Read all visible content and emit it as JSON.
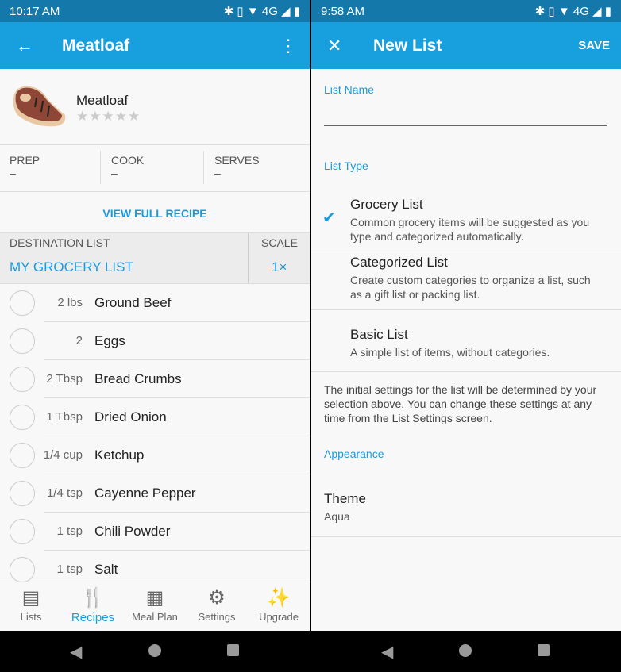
{
  "left": {
    "status": {
      "time": "10:17 AM",
      "icons": "✱ ▯ ▼ 4G ◢ ▮"
    },
    "appbar": {
      "title": "Meatloaf"
    },
    "recipe": {
      "name": "Meatloaf",
      "rating": 0,
      "stars": "★★★★★"
    },
    "times": [
      {
        "label": "PREP",
        "value": "–"
      },
      {
        "label": "COOK",
        "value": "–"
      },
      {
        "label": "SERVES",
        "value": "–"
      }
    ],
    "view_full": "VIEW FULL RECIPE",
    "destination": {
      "label": "DESTINATION LIST",
      "value": "MY GROCERY LIST",
      "scale_label": "SCALE",
      "scale_value": "1×"
    },
    "ingredients": [
      {
        "qty": "2 lbs",
        "name": "Ground Beef"
      },
      {
        "qty": "2",
        "name": "Eggs"
      },
      {
        "qty": "2 Tbsp",
        "name": "Bread Crumbs"
      },
      {
        "qty": "1 Tbsp",
        "name": "Dried Onion"
      },
      {
        "qty": "1/4 cup",
        "name": "Ketchup"
      },
      {
        "qty": "1/4 tsp",
        "name": "Cayenne Pepper"
      },
      {
        "qty": "1 tsp",
        "name": "Chili Powder"
      },
      {
        "qty": "1 tsp",
        "name": "Salt"
      }
    ],
    "tabs": [
      {
        "label": "Lists",
        "icon": "lists-icon"
      },
      {
        "label": "Recipes",
        "icon": "fork-spoon-icon",
        "active": true
      },
      {
        "label": "Meal Plan",
        "icon": "calendar-icon"
      },
      {
        "label": "Settings",
        "icon": "gear-icon"
      },
      {
        "label": "Upgrade",
        "icon": "magic-wand-icon"
      }
    ]
  },
  "right": {
    "status": {
      "time": "9:58 AM",
      "icons": "✱ ▯ ▼ 4G ◢ ▮"
    },
    "appbar": {
      "title": "New List",
      "save": "SAVE"
    },
    "list_name_label": "List Name",
    "list_name_value": "",
    "list_type_label": "List Type",
    "options": [
      {
        "title": "Grocery List",
        "desc": "Common grocery items will be suggested as you type and categorized automatically.",
        "selected": true
      },
      {
        "title": "Categorized List",
        "desc": "Create custom categories to organize a list, such as a gift list or packing list."
      },
      {
        "title": "Basic List",
        "desc": "A simple list of items, without categories."
      }
    ],
    "note": "The initial settings for the list will be determined by your selection above. You can change these settings at any time from the List Settings screen.",
    "appearance_label": "Appearance",
    "theme": {
      "label": "Theme",
      "value": "Aqua"
    }
  },
  "colors": {
    "accent": "#189fdd",
    "status": "#1479aa"
  }
}
